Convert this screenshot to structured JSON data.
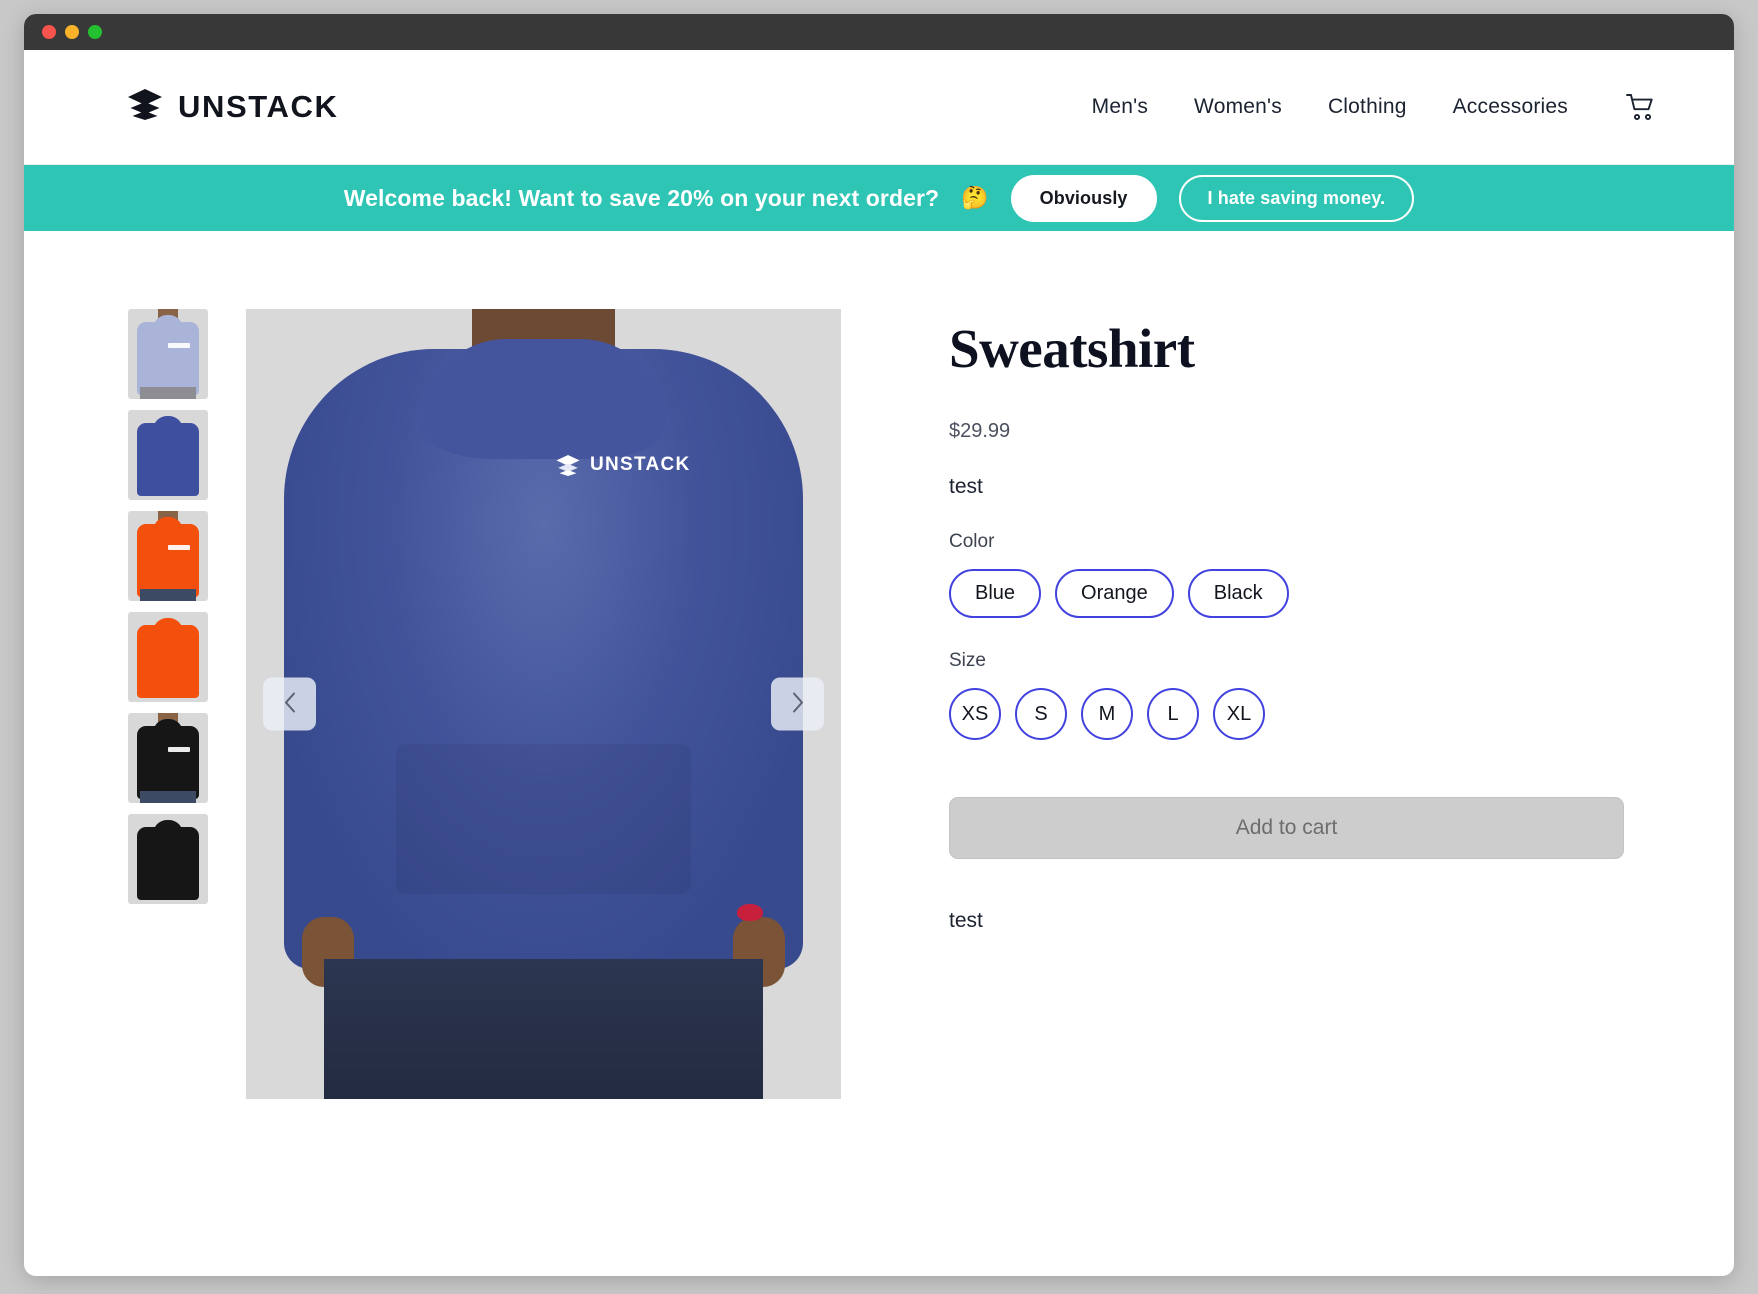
{
  "window": {
    "traffic_lights": [
      "close",
      "minimize",
      "zoom"
    ]
  },
  "header": {
    "brand_name": "UNSTACK",
    "logo_icon": "stacked-layers-icon",
    "nav": [
      {
        "label": "Men's"
      },
      {
        "label": "Women's"
      },
      {
        "label": "Clothing"
      },
      {
        "label": "Accessories"
      }
    ],
    "cart_icon": "shopping-cart-icon"
  },
  "promo": {
    "message": "Welcome back! Want to save 20% on your next order?",
    "emoji": "🤔",
    "accept_label": "Obviously",
    "decline_label": "I hate saving money.",
    "background_color": "#2fc5b5"
  },
  "gallery": {
    "prev_icon": "chevron-left-icon",
    "next_icon": "chevron-right-icon",
    "main_image_alt": "Blue Champion hoodie front with UNSTACK chest logo",
    "chest_logo_text": "UNSTACK",
    "thumbnails": [
      {
        "alt": "Light blue hoodie front",
        "color": "#aab4d8",
        "view": "front",
        "selected": false
      },
      {
        "alt": "Blue hoodie back",
        "color": "#3e4fa0",
        "view": "back",
        "selected": false
      },
      {
        "alt": "Orange hoodie front",
        "color": "#f4500d",
        "view": "front",
        "selected": false
      },
      {
        "alt": "Orange hoodie back",
        "color": "#f4500d",
        "view": "back",
        "selected": false
      },
      {
        "alt": "Black hoodie front",
        "color": "#161616",
        "view": "front",
        "selected": false
      },
      {
        "alt": "Black hoodie back",
        "color": "#161616",
        "view": "back",
        "selected": false
      }
    ]
  },
  "product": {
    "title": "Sweatshirt",
    "price": "$29.99",
    "description_top": "test",
    "description_bottom": "test",
    "color_label": "Color",
    "colors": [
      {
        "label": "Blue"
      },
      {
        "label": "Orange"
      },
      {
        "label": "Black"
      }
    ],
    "size_label": "Size",
    "sizes": [
      {
        "label": "XS"
      },
      {
        "label": "S"
      },
      {
        "label": "M"
      },
      {
        "label": "L"
      },
      {
        "label": "XL"
      }
    ],
    "add_to_cart_label": "Add to cart",
    "add_to_cart_enabled": false,
    "option_accent_color": "#4242e0"
  }
}
